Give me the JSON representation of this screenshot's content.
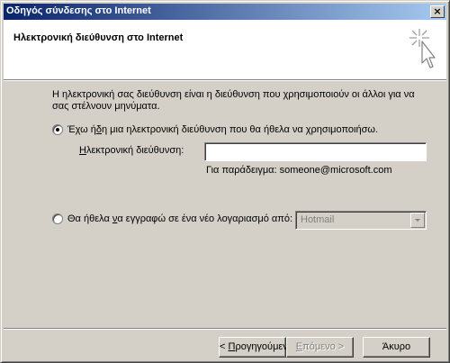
{
  "window": {
    "title": "Οδηγός σύνδεσης στο Internet",
    "close_label": "×"
  },
  "header": {
    "title": "Ηλεκτρονική διεύθυνση στο Internet",
    "icon": "wizard-cursor-icon"
  },
  "content": {
    "intro_line1": "Η ηλεκτρονική σας διεύθυνση είναι η διεύθυνση που χρησιμοποιούν οι άλλοι για να",
    "intro_line2": "σας στέλνουν μηνύματα.",
    "option_existing": {
      "label_pre": "Έχω ή",
      "label_underline": "δ",
      "label_post": "η μια ηλεκτρονική διεύθυνση που θα ήθελα να χρησιμοποιήσω.",
      "selected": true
    },
    "email": {
      "label_underline": "Η",
      "label_post": "λεκτρονική διεύθυνση:",
      "value": "",
      "example": "Για παράδειγμα: someone@microsoft.com"
    },
    "option_new": {
      "label_pre": "Θα ήθελα ",
      "label_underline": "ν",
      "label_post": "α εγγραφώ σε ένα νέο λογαριασμό από:",
      "selected": false
    },
    "provider_select": {
      "value": "Hotmail",
      "disabled": true
    }
  },
  "footer": {
    "back_pre": "< ",
    "back_underline": "Π",
    "back_post": "ρογηγούμενο",
    "next_pre": "",
    "next_underline": "Ε",
    "next_post": "πόμενο >",
    "cancel_label": "Άκυρο"
  },
  "colors": {
    "titlebar_start": "#0a246a",
    "titlebar_end": "#a6caf0",
    "face": "#d4d0c8"
  }
}
